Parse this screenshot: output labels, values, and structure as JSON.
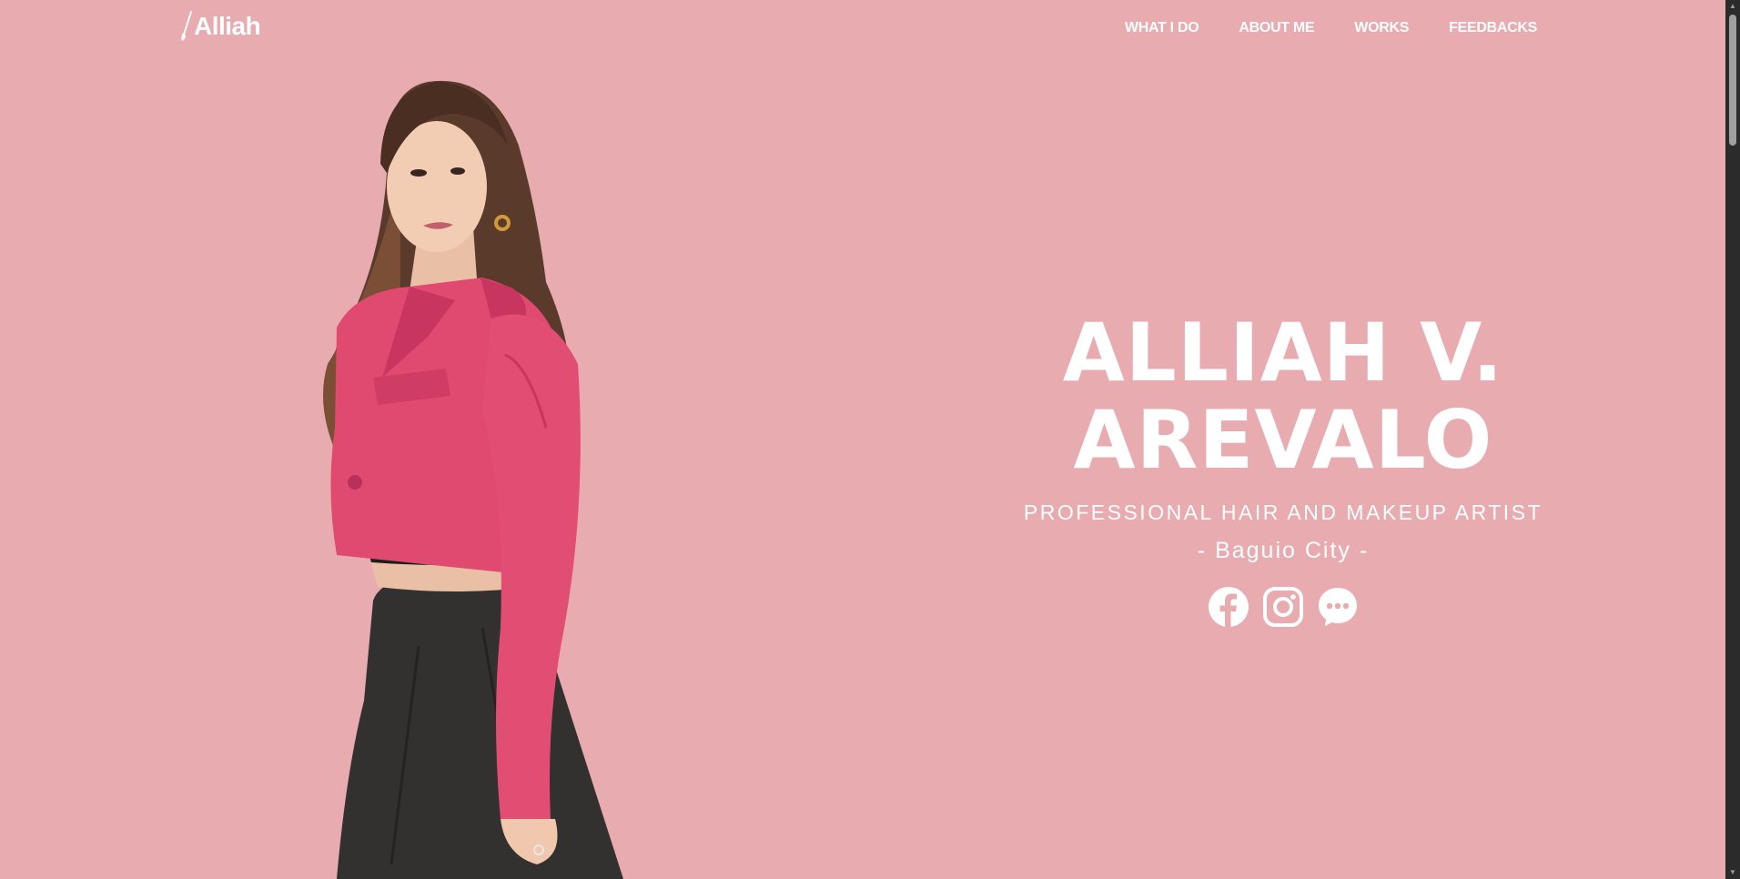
{
  "nav": {
    "logo": "Alliah",
    "links": [
      "WHAT I DO",
      "ABOUT ME",
      "WORKS",
      "FEEDBACKS"
    ]
  },
  "hero": {
    "name_line1": "ALLIAH V.",
    "name_line2": "AREVALO",
    "title": "PROFESSIONAL HAIR AND MAKEUP ARTIST",
    "location": "- Baguio City -"
  },
  "socials": [
    "facebook-icon",
    "instagram-icon",
    "messenger-icon"
  ],
  "colors": {
    "background": "#e8abb0",
    "text": "#ffffff",
    "jacket": "#e04a70",
    "skirt": "#333030"
  }
}
